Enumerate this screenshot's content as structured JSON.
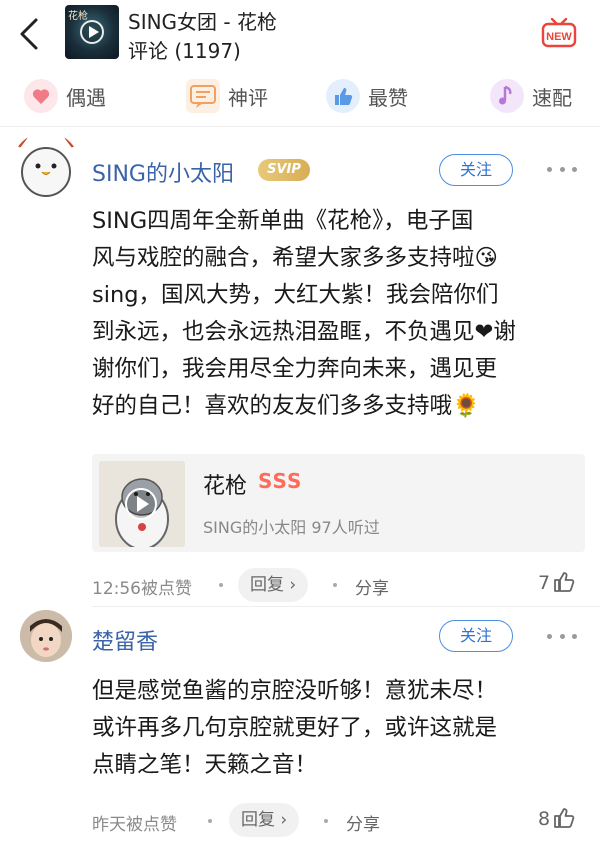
{
  "header": {
    "title": "SING女团 - 花枪",
    "subtitle": "评论 (1197)",
    "cover_text": "花枪",
    "new_badge": "NEW",
    "icons": {
      "back": "back-arrow-icon",
      "new": "new-badge-icon"
    }
  },
  "tabs": [
    {
      "label": "偶遇",
      "icon": "heart-icon",
      "color": "#f07a86"
    },
    {
      "label": "神评",
      "icon": "comment-icon",
      "color": "#f0a060"
    },
    {
      "label": "最赞",
      "icon": "thumb-up-icon",
      "color": "#5b98e6"
    },
    {
      "label": "速配",
      "icon": "music-note-icon",
      "color": "#b578d9"
    }
  ],
  "comments": [
    {
      "username": "SING的小太阳",
      "badge": "SVIP",
      "follow_label": "关注",
      "text_lines": [
        "SING四周年全新单曲《花枪》，电子国",
        "风与戏腔的融合，希望大家多多支持啦😘",
        "sing，国风大势，大红大紫！我会陪你们",
        "到永远，也会永远热泪盈眶，不负遇见❤谢",
        "谢你们，我会用尽全力奔向未来，遇见更",
        "好的自己！喜欢的友友们多多支持哦🌻"
      ],
      "song": {
        "name": "花枪",
        "tag": "SSS",
        "meta": "SING的小太阳  97人听过"
      },
      "time": "12:56被点赞",
      "reply_label": "回复 ›",
      "share_label": "分享",
      "likes": "7"
    },
    {
      "username": "楚留香",
      "follow_label": "关注",
      "text_lines": [
        "但是感觉鱼酱的京腔没听够！意犹未尽！",
        "或许再多几句京腔就更好了，或许这就是",
        "点睛之笔！天籁之音！"
      ],
      "time": "昨天被点赞",
      "reply_label": "回复 ›",
      "share_label": "分享",
      "likes": "8"
    }
  ],
  "colors": {
    "username": "#3a63a8",
    "accent_blue": "#4a8fe0",
    "sss": "#ff6b5a",
    "svip": "#d8ad55"
  }
}
